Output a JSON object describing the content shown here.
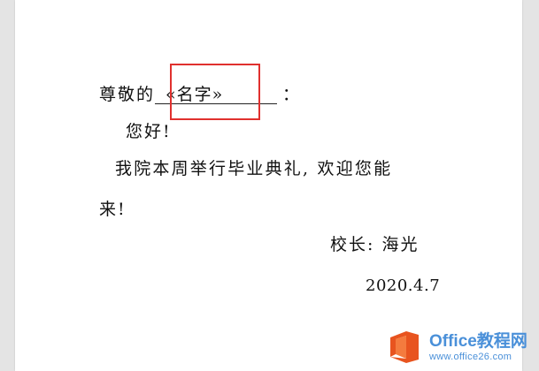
{
  "document": {
    "greeting": "尊敬的",
    "merge_field": "«名字»",
    "colon": "：",
    "hello": "您好!",
    "body_line1": "我院本周举行毕业典礼, 欢迎您能",
    "body_line2": "来!",
    "signature": "校长: 海光",
    "date": "2020.4.7"
  },
  "watermark": {
    "title": "Office教程网",
    "url": "www.office26.com",
    "logo_icon": "office-logo-icon",
    "color": "#4a90d9",
    "logo_color": "#e8541f"
  },
  "highlight": {
    "color": "#e0302e"
  }
}
